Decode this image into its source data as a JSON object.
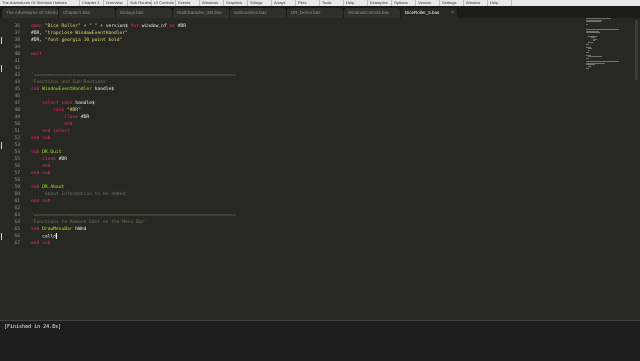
{
  "menu": [
    "The Adventures Of Sherlock Holmes",
    "Chapter 1",
    "Overview",
    "Sub Routines",
    "UI Controls",
    "Events",
    "Windows",
    "Graphics",
    "Strings",
    "Arrays",
    "Files",
    "Tools",
    "Help",
    "Examples",
    "Options",
    "Version",
    "Settings",
    "Window",
    "Help"
  ],
  "tabs": [
    {
      "label": "The Adventures Of Sherlock Holmes"
    },
    {
      "label": "Chapter1.bas"
    },
    {
      "label": "Dialogs.bas"
    },
    {
      "label": "RollCharacter_SR.bas"
    },
    {
      "label": "Subroutines.bas"
    },
    {
      "label": "DR_Demo.bas"
    },
    {
      "label": "WindowControls.bas"
    },
    {
      "label": "DiceRoller_5.bas"
    }
  ],
  "editor": {
    "lines": [
      {
        "n": "36",
        "t": "open \"Dice Roller\" + \" \" + version$ for window_nf as #DR",
        "m": false
      },
      {
        "n": "37",
        "t": "#DR, \"trapclose WindowEventHandler\"",
        "m": false
      },
      {
        "n": "38",
        "t": "#DR, \"font georgia 10 point bold\"",
        "m": true
      },
      {
        "n": "39",
        "t": "",
        "m": false
      },
      {
        "n": "40",
        "t": "wait",
        "m": false
      },
      {
        "n": "41",
        "t": "",
        "m": false
      },
      {
        "n": "42",
        "t": "",
        "m": true
      },
      {
        "n": "43",
        "t": "'=========================================================================",
        "m": false
      },
      {
        "n": "44",
        "t": "'Functions and Sub Routines'",
        "m": false
      },
      {
        "n": "45",
        "t": "sub WindowEventHandler handle$",
        "m": false
      },
      {
        "n": "46",
        "t": "",
        "m": false
      },
      {
        "n": "47",
        "t": "    select case handle$",
        "m": false
      },
      {
        "n": "48",
        "t": "        case \"#DR\"",
        "m": false
      },
      {
        "n": "49",
        "t": "            close #DR",
        "m": false
      },
      {
        "n": "50",
        "t": "            end",
        "m": false
      },
      {
        "n": "51",
        "t": "    end select",
        "m": false
      },
      {
        "n": "52",
        "t": "end sub",
        "m": false
      },
      {
        "n": "53",
        "t": "",
        "m": true
      },
      {
        "n": "54",
        "t": "sub DR.Quit",
        "m": false
      },
      {
        "n": "55",
        "t": "    close #DR",
        "m": false
      },
      {
        "n": "56",
        "t": "    end",
        "m": false
      },
      {
        "n": "57",
        "t": "end sub",
        "m": false
      },
      {
        "n": "58",
        "t": "",
        "m": false
      },
      {
        "n": "59",
        "t": "sub DR.About",
        "m": false
      },
      {
        "n": "60",
        "t": "    'About Information to be added'",
        "m": false
      },
      {
        "n": "61",
        "t": "end sub",
        "m": false
      },
      {
        "n": "62",
        "t": "",
        "m": false
      },
      {
        "n": "63",
        "t": "'=========================================================================",
        "m": false
      },
      {
        "n": "64",
        "t": "'Functions to Remove Edit on the Menu Bar'",
        "m": false
      },
      {
        "n": "65",
        "t": "sub DrawMenuBar hWnd",
        "m": false
      },
      {
        "n": "66",
        "t": "    calld",
        "m": true
      },
      {
        "n": "67",
        "t": "end sub",
        "m": false
      }
    ]
  },
  "output": {
    "text": "[Finished in 24.8s]"
  },
  "colors": {
    "keyword": "#f92672",
    "string": "#e6db74",
    "number": "#ae81ff",
    "comment": "#75715e",
    "function": "#a6e22e",
    "background": "#272822"
  }
}
